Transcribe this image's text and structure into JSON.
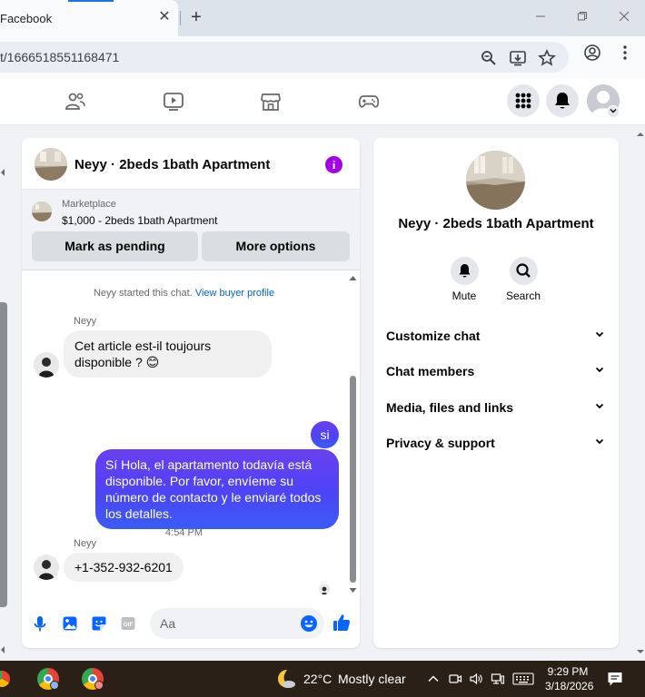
{
  "browser": {
    "tab_title": "Facebook",
    "tab_close": "✕",
    "new_tab": "+",
    "url": "t/1666518551168471"
  },
  "conversation": {
    "title": "Neyy · 2beds 1bath Apartment",
    "listing": {
      "source": "Marketplace",
      "summary": "$1,000 - 2beds 1bath Apartment",
      "mark_pending": "Mark as pending",
      "more_options": "More options"
    },
    "system_message": "Neyy started this chat.",
    "system_link": "View buyer profile",
    "messages": [
      {
        "sender": "Neyy",
        "text": "Cet article est-il toujours disponible ? 😊"
      },
      {
        "time": "4:54 PM"
      },
      {
        "outgoing": "si"
      },
      {
        "outgoing": "Sí Hola, el apartamento todavía está disponible. Por favor, envíeme su número de contacto y le enviaré todos los detalles."
      },
      {
        "sender": "Neyy",
        "text": "+1-352-932-6201"
      }
    ],
    "composer_placeholder": "Aa"
  },
  "info_panel": {
    "title": "Neyy · 2beds 1bath Apartment",
    "actions": [
      "Mute",
      "Search"
    ],
    "sections": [
      "Customize chat",
      "Chat members",
      "Media, files and links",
      "Privacy & support"
    ]
  },
  "taskbar": {
    "temperature": "22°C",
    "weather": "Mostly clear",
    "time": "9:29 PM",
    "date": "3/18/2026"
  },
  "colors": {
    "accent_blue": "#0866ff",
    "outgoing_gradient_top": "#6a3ff0",
    "outgoing_gradient_bottom": "#3b5cf5",
    "info_purple": "#a100e6"
  }
}
